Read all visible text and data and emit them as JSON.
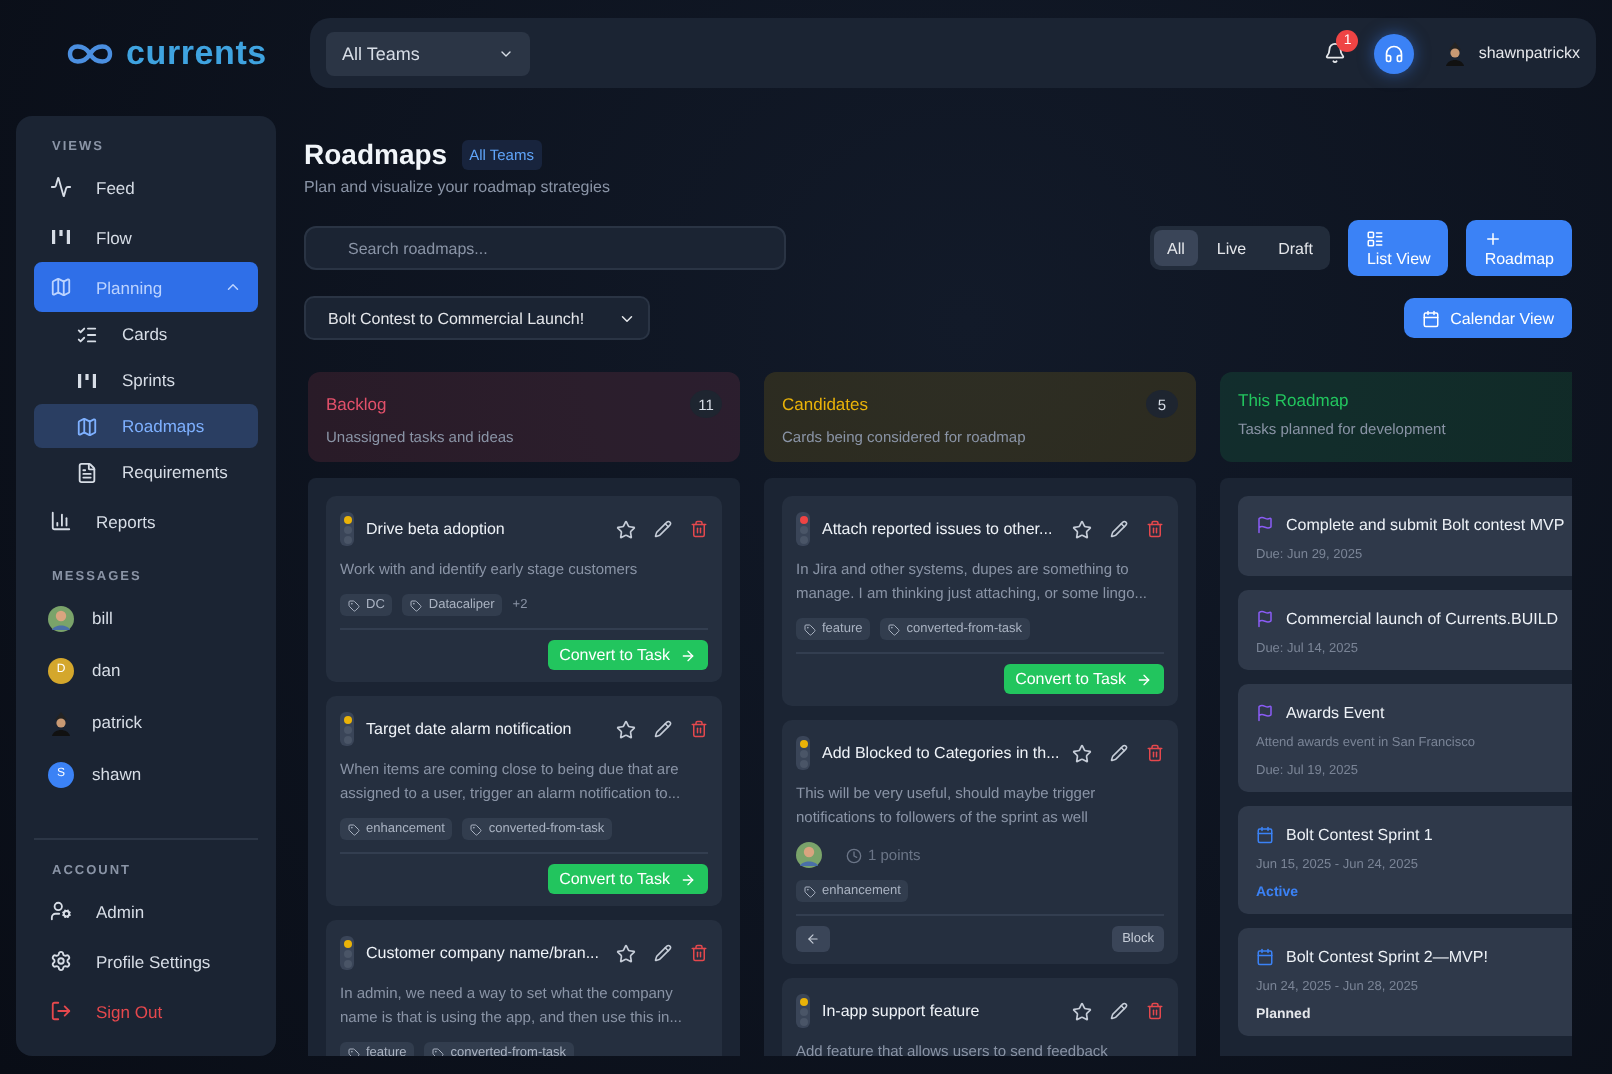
{
  "brand": {
    "name": "currents"
  },
  "topbar": {
    "team_select": "All Teams",
    "notifications": "1",
    "username": "shawnpatrickx"
  },
  "sidebar": {
    "sections": [
      {
        "title": "VIEWS",
        "items": [
          {
            "label": "Feed",
            "selected": false
          },
          {
            "label": "Flow",
            "selected": false
          },
          {
            "label": "Planning",
            "selected": true,
            "expanded": true,
            "children": [
              {
                "label": "Cards",
                "selected": false
              },
              {
                "label": "Sprints",
                "selected": false
              },
              {
                "label": "Roadmaps",
                "selected": true
              },
              {
                "label": "Requirements",
                "selected": false
              }
            ]
          },
          {
            "label": "Reports",
            "selected": false
          }
        ]
      }
    ],
    "messages_title": "MESSAGES",
    "messages": [
      {
        "name": "bill",
        "kind": "photo"
      },
      {
        "name": "dan",
        "kind": "initial",
        "initial": "D",
        "color": "#d4a72c"
      },
      {
        "name": "patrick",
        "kind": "figure"
      },
      {
        "name": "shawn",
        "kind": "initial",
        "initial": "S",
        "color": "#3b82f6"
      }
    ],
    "account_title": "ACCOUNT",
    "account": [
      {
        "label": "Admin",
        "danger": false
      },
      {
        "label": "Profile Settings",
        "danger": false
      },
      {
        "label": "Sign Out",
        "danger": true
      }
    ]
  },
  "page": {
    "title": "Roadmaps",
    "badge": "All Teams",
    "subtitle": "Plan and visualize your roadmap strategies",
    "search": {
      "placeholder": "Search roadmaps..."
    },
    "filters": [
      {
        "label": "All",
        "selected": true
      },
      {
        "label": "Live",
        "selected": false
      },
      {
        "label": "Draft",
        "selected": false
      }
    ],
    "buttons": [
      "List View",
      "Roadmap"
    ],
    "roadmap_select": "Bolt Contest to Commercial Launch!",
    "calendar_button": "Calendar View"
  },
  "columns": [
    {
      "title": "Backlog",
      "subtitle": "Unassigned tasks and ideas",
      "count": "11",
      "color": "#e2506a",
      "cards": [
        {
          "kind": "task",
          "color": "#eab308",
          "title": "Drive beta adoption",
          "description": "Work with and identify early stage customers",
          "tags": [
            "DC",
            "Datacaliper"
          ],
          "more": "+2",
          "action": "Convert to Task"
        },
        {
          "kind": "task",
          "color": "#eab308",
          "title": "Target date alarm notification",
          "description": "When items are coming close to being due that are assigned to a user, trigger an alarm notification to...",
          "tags": [
            "enhancement",
            "converted-from-task"
          ],
          "action": "Convert to Task"
        },
        {
          "kind": "task",
          "color": "#eab308",
          "title": "Customer company name/bran...",
          "description": "In admin, we need a way to set what the company name is that is using the app, and then use this in...",
          "tags": [
            "feature",
            "converted-from-task"
          ]
        }
      ]
    },
    {
      "title": "Candidates",
      "subtitle": "Cards being considered for roadmap",
      "count": "5",
      "color": "#eab308",
      "cards": [
        {
          "kind": "task",
          "color": "#ef4444",
          "title": "Attach reported issues to other...",
          "description": "In Jira and other systems, dupes are something to manage. I am thinking just attaching, or some lingo...",
          "tags": [
            "feature",
            "converted-from-task"
          ],
          "action": "Convert to Task"
        },
        {
          "kind": "task",
          "color": "#eab308",
          "title": "Add Blocked to Categories in th...",
          "description": "This will be very useful, should maybe trigger notifications to followers of the sprint as well",
          "points": "1 points",
          "tags": [
            "enhancement"
          ],
          "block": "Block"
        },
        {
          "kind": "task",
          "color": "#eab308",
          "title": "In-app support feature",
          "description": "Add feature that allows users to send feedback"
        }
      ]
    },
    {
      "title": "This Roadmap",
      "subtitle": "Tasks planned for development",
      "color": "#22c55e",
      "cards": [
        {
          "kind": "milestone",
          "title": "Complete and submit Bolt contest MVP",
          "date": "Due: Jun 29, 2025"
        },
        {
          "kind": "milestone",
          "title": "Commercial launch of Currents.BUILD",
          "date": "Due: Jul 14, 2025"
        },
        {
          "kind": "milestone",
          "title": "Awards Event",
          "description": "Attend awards event in San Francisco",
          "date": "Due: Jul 19, 2025"
        },
        {
          "kind": "sprint",
          "title": "Bolt Contest Sprint 1",
          "date": "Jun 15, 2025 - Jun 24, 2025",
          "status": "Active",
          "active": true
        },
        {
          "kind": "sprint",
          "title": "Bolt Contest Sprint 2—MVP!",
          "date": "Jun 24, 2025 - Jun 28, 2025",
          "status": "Planned",
          "active": false
        }
      ]
    }
  ]
}
